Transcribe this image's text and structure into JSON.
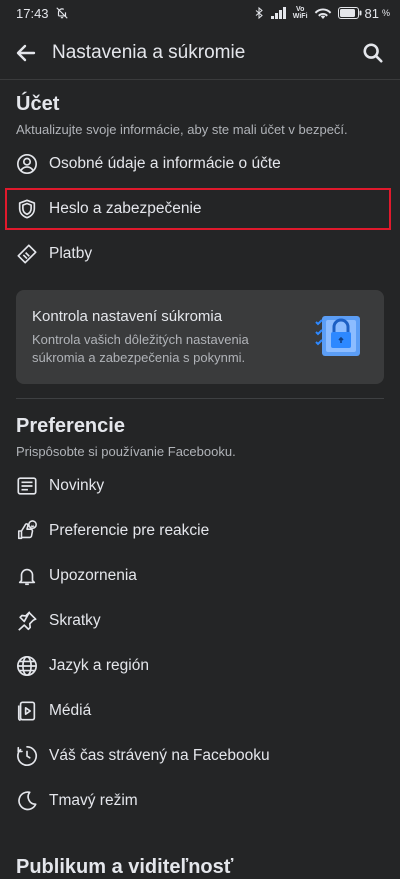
{
  "status_bar": {
    "time": "17:43",
    "vowifi_top": "Vo",
    "vowifi_bottom": "WiFi",
    "battery": "81"
  },
  "app_bar": {
    "title": "Nastavenia a súkromie"
  },
  "account": {
    "title": "Účet",
    "subtitle": "Aktualizujte svoje informácie, aby ste mali účet v bezpečí.",
    "items": [
      {
        "label": "Osobné údaje a informácie o účte",
        "icon": "person-circle-icon"
      },
      {
        "label": "Heslo a zabezpečenie",
        "icon": "shield-icon"
      },
      {
        "label": "Platby",
        "icon": "tag-icon"
      }
    ]
  },
  "privacy_card": {
    "title": "Kontrola nastavení súkromia",
    "description": "Kontrola vašich dôležitých nastavenia súkromia a zabezpečenia s pokynmi.",
    "icon": "privacy-checkup-lock-icon"
  },
  "preferences": {
    "title": "Preferencie",
    "subtitle": "Prispôsobte si používanie Facebooku.",
    "items": [
      {
        "label": "Novinky",
        "icon": "news-feed-icon"
      },
      {
        "label": "Preferencie pre reakcie",
        "icon": "reactions-icon"
      },
      {
        "label": "Upozornenia",
        "icon": "bell-icon"
      },
      {
        "label": "Skratky",
        "icon": "pin-icon"
      },
      {
        "label": "Jazyk a región",
        "icon": "globe-icon"
      },
      {
        "label": "Médiá",
        "icon": "media-icon"
      },
      {
        "label": "Váš čas strávený na Facebooku",
        "icon": "clock-icon"
      },
      {
        "label": "Tmavý režim",
        "icon": "moon-icon"
      }
    ]
  },
  "next_section_partial": "Publikum a viditeľnosť",
  "colors": {
    "background": "#242526",
    "card": "#3a3b3c",
    "text": "#e4e6eb",
    "secondary_text": "#b0b3b8",
    "highlight": "#e0192c",
    "lock_blue": "#2d88ff"
  }
}
